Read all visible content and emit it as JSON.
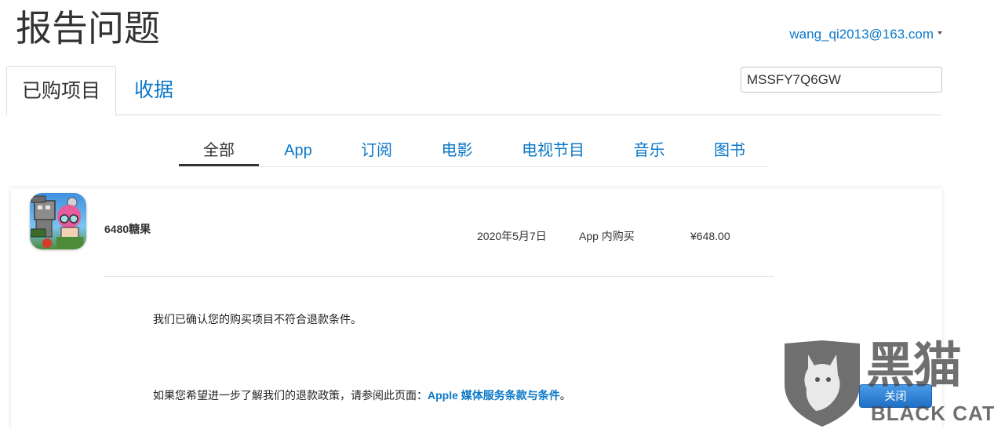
{
  "page": {
    "title": "报告问题"
  },
  "account": {
    "email": "wang_qi2013@163.com",
    "icon": "chevron-down-icon"
  },
  "tabs": [
    {
      "label": "已购项目",
      "active": true
    },
    {
      "label": "收据",
      "active": false
    }
  ],
  "search": {
    "value": "MSSFY7Q6GW"
  },
  "categories": [
    {
      "label": "全部",
      "active": true
    },
    {
      "label": "App",
      "active": false
    },
    {
      "label": "订阅",
      "active": false
    },
    {
      "label": "电影",
      "active": false
    },
    {
      "label": "电视节目",
      "active": false
    },
    {
      "label": "音乐",
      "active": false
    },
    {
      "label": "图书",
      "active": false
    }
  ],
  "purchase": {
    "icon": "game-app-icon",
    "name": "6480糖果",
    "date": "2020年5月7日",
    "type": "App 内购买",
    "price": "¥648.00"
  },
  "message": {
    "line1": "我们已确认您的购买项目不符合退款条件。",
    "line2_prefix": "如果您希望进一步了解我们的退款政策，请参阅此页面：",
    "link": "Apple 媒体服务条款与条件",
    "line2_suffix": "。"
  },
  "close_button": {
    "label": "关闭"
  },
  "watermark": {
    "cn": "黑猫",
    "en": "BLACK CAT",
    "icon": "cat-shield-icon"
  },
  "colors": {
    "link": "#0b77c8",
    "text": "#333333",
    "button": "#1f6fc6"
  }
}
